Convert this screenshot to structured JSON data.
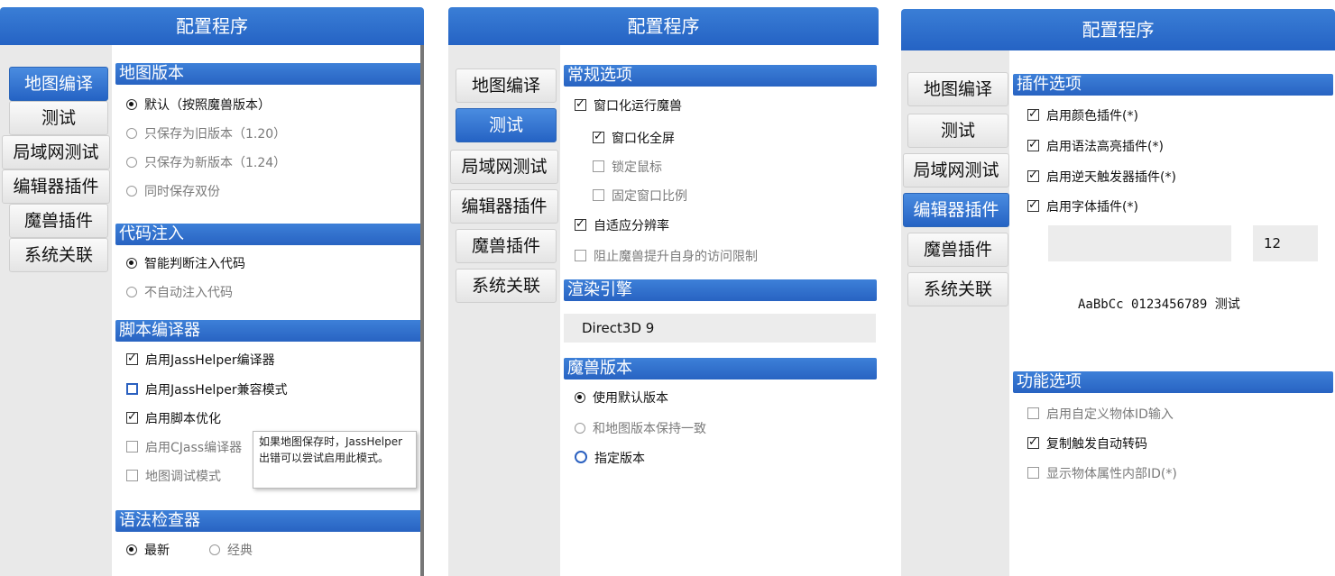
{
  "panel1": {
    "title": "配置程序",
    "nav": [
      "地图编译",
      "测试",
      "局域网测试",
      "编辑器插件",
      "魔兽插件",
      "系统关联"
    ],
    "sections": {
      "map_version": {
        "header": "地图版本",
        "options": [
          "默认（按照魔兽版本）",
          "只保存为旧版本（1.20）",
          "只保存为新版本（1.24）",
          "同时保存双份"
        ]
      },
      "code_injection": {
        "header": "代码注入",
        "options": [
          "智能判断注入代码",
          "不自动注入代码"
        ]
      },
      "script_compiler": {
        "header": "脚本编译器",
        "options": [
          "启用JassHelper编译器",
          "启用JassHelper兼容模式",
          "启用脚本优化",
          "启用CJass编译器",
          "地图调试模式"
        ]
      },
      "syntax_checker": {
        "header": "语法检查器",
        "options": [
          "最新",
          "经典"
        ]
      }
    },
    "tooltip": "如果地图保存时，JassHelper出错可以尝试启用此模式。"
  },
  "panel2": {
    "title": "配置程序",
    "nav": [
      "地图编译",
      "测试",
      "局域网测试",
      "编辑器插件",
      "魔兽插件",
      "系统关联"
    ],
    "sections": {
      "general": {
        "header": "常规选项",
        "options": [
          "窗口化运行魔兽",
          "窗口化全屏",
          "锁定鼠标",
          "固定窗口比例",
          "自适应分辨率",
          "阻止魔兽提升自身的访问限制"
        ]
      },
      "render": {
        "header": "渲染引擎",
        "value": "Direct3D 9"
      },
      "wc3_version": {
        "header": "魔兽版本",
        "options": [
          "使用默认版本",
          "和地图版本保持一致",
          "指定版本"
        ]
      }
    }
  },
  "panel3": {
    "title": "配置程序",
    "nav": [
      "地图编译",
      "测试",
      "局域网测试",
      "编辑器插件",
      "魔兽插件",
      "系统关联"
    ],
    "sections": {
      "plugins": {
        "header": "插件选项",
        "options": [
          "启用颜色插件(*)",
          "启用语法高亮插件(*)",
          "启用逆天触发器插件(*)",
          "启用字体插件(*)"
        ],
        "font_size": "12",
        "font_preview": "AaBbCc 0123456789 测试"
      },
      "features": {
        "header": "功能选项",
        "options": [
          "启用自定义物体ID输入",
          "复制触发自动转码",
          "显示物体属性内部ID(*)"
        ]
      }
    }
  }
}
